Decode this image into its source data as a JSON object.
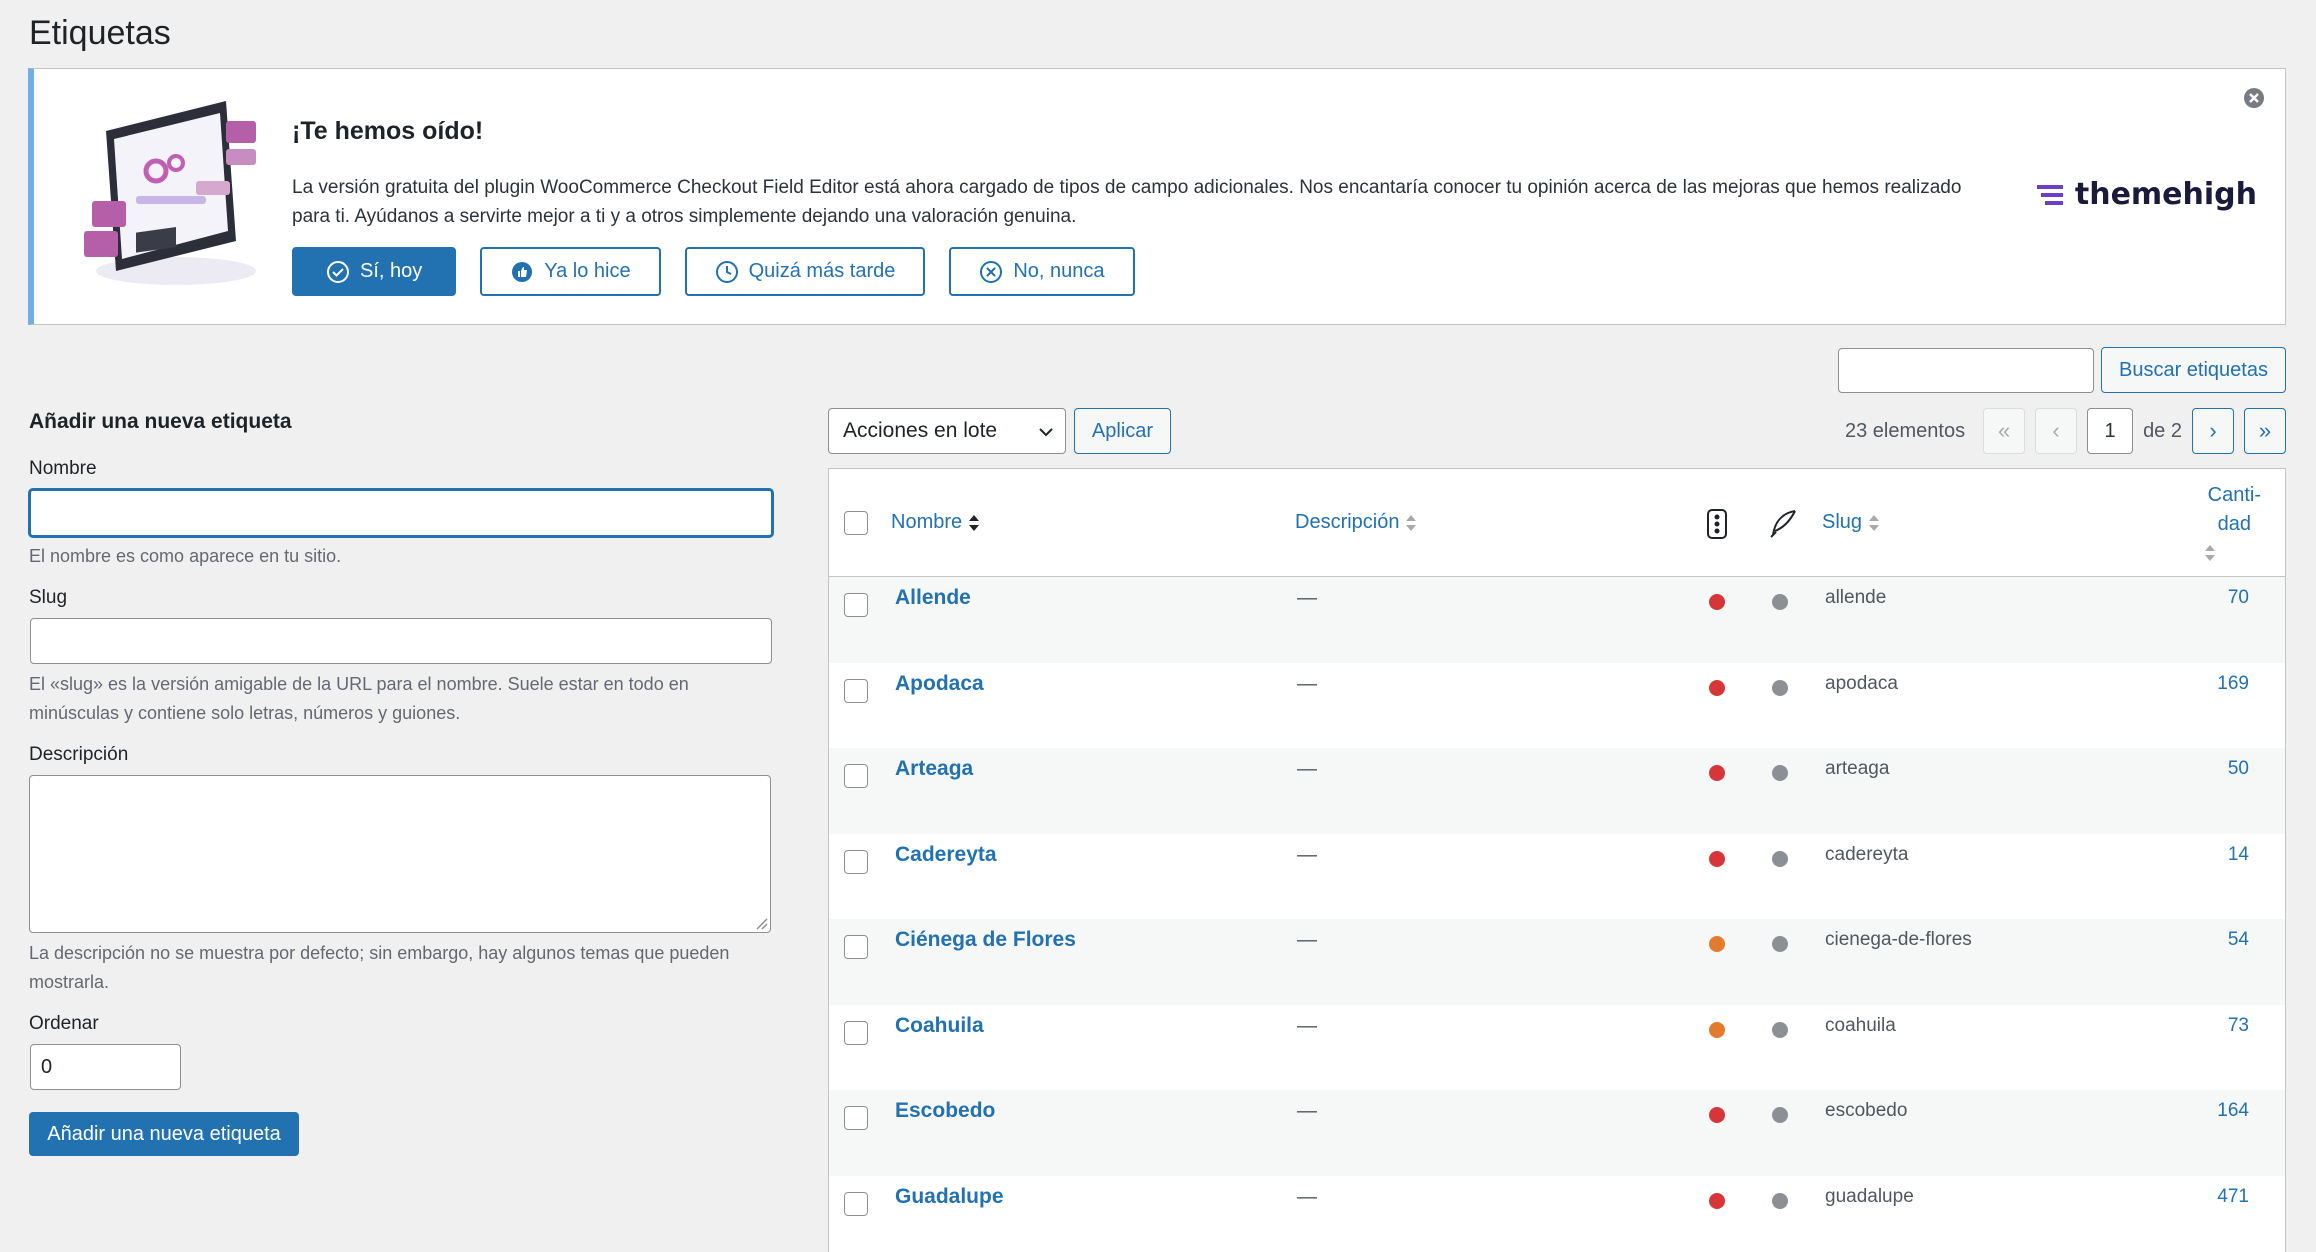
{
  "page": {
    "title": "Etiquetas"
  },
  "notice": {
    "title": "¡Te hemos oído!",
    "text": "La versión gratuita del plugin WooCommerce Checkout Field Editor está ahora cargado de tipos de campo adicionales. Nos encantaría conocer tu opinión acerca de las mejoras que hemos realizado para ti. Ayúdanos a servirte mejor a ti y a otros simplemente dejando una valoración genuina.",
    "buttons": {
      "yes_today": "Sí, hoy",
      "already_did": "Ya lo hice",
      "maybe_later": "Quizá más tarde",
      "no_never": "No, nunca"
    },
    "brand": "themehigh"
  },
  "search": {
    "button": "Buscar etiquetas",
    "value": ""
  },
  "form": {
    "heading": "Añadir una nueva etiqueta",
    "name_label": "Nombre",
    "name_help": "El nombre es como aparece en tu sitio.",
    "slug_label": "Slug",
    "slug_help": "El «slug» es la versión amigable de la URL para el nombre. Suele estar en todo en minúsculas y contiene solo letras, números y guiones.",
    "description_label": "Descripción",
    "description_help": "La descripción no se muestra por defecto; sin embargo, hay algunos temas que pueden mostrarla.",
    "order_label": "Ordenar",
    "order_value": "0",
    "submit": "Añadir una nueva etiqueta"
  },
  "toolbar": {
    "bulk_actions": "Acciones en lote",
    "apply": "Aplicar",
    "items_count": "23 elementos",
    "first": "«",
    "prev": "‹",
    "current_page": "1",
    "of_pages": "de 2",
    "next": "›",
    "last": "»"
  },
  "table": {
    "headers": {
      "name": "Nombre",
      "description": "Descripción",
      "slug": "Slug",
      "count_line1": "Canti-",
      "count_line2": "dad"
    },
    "colors": {
      "red": "#d63638",
      "orange": "#e37b2d",
      "gray": "#8c8f94"
    },
    "rows": [
      {
        "name": "Allende",
        "description": "—",
        "status": "red",
        "slug": "allende",
        "count": "70"
      },
      {
        "name": "Apodaca",
        "description": "—",
        "status": "red",
        "slug": "apodaca",
        "count": "169"
      },
      {
        "name": "Arteaga",
        "description": "—",
        "status": "red",
        "slug": "arteaga",
        "count": "50"
      },
      {
        "name": "Cadereyta",
        "description": "—",
        "status": "red",
        "slug": "cadereyta",
        "count": "14"
      },
      {
        "name": "Ciénega de Flores",
        "description": "—",
        "status": "orange",
        "slug": "cienega-de-flores",
        "count": "54"
      },
      {
        "name": "Coahuila",
        "description": "—",
        "status": "orange",
        "slug": "coahuila",
        "count": "73"
      },
      {
        "name": "Escobedo",
        "description": "—",
        "status": "red",
        "slug": "escobedo",
        "count": "164"
      },
      {
        "name": "Guadalupe",
        "description": "—",
        "status": "red",
        "slug": "guadalupe",
        "count": "471"
      }
    ]
  }
}
